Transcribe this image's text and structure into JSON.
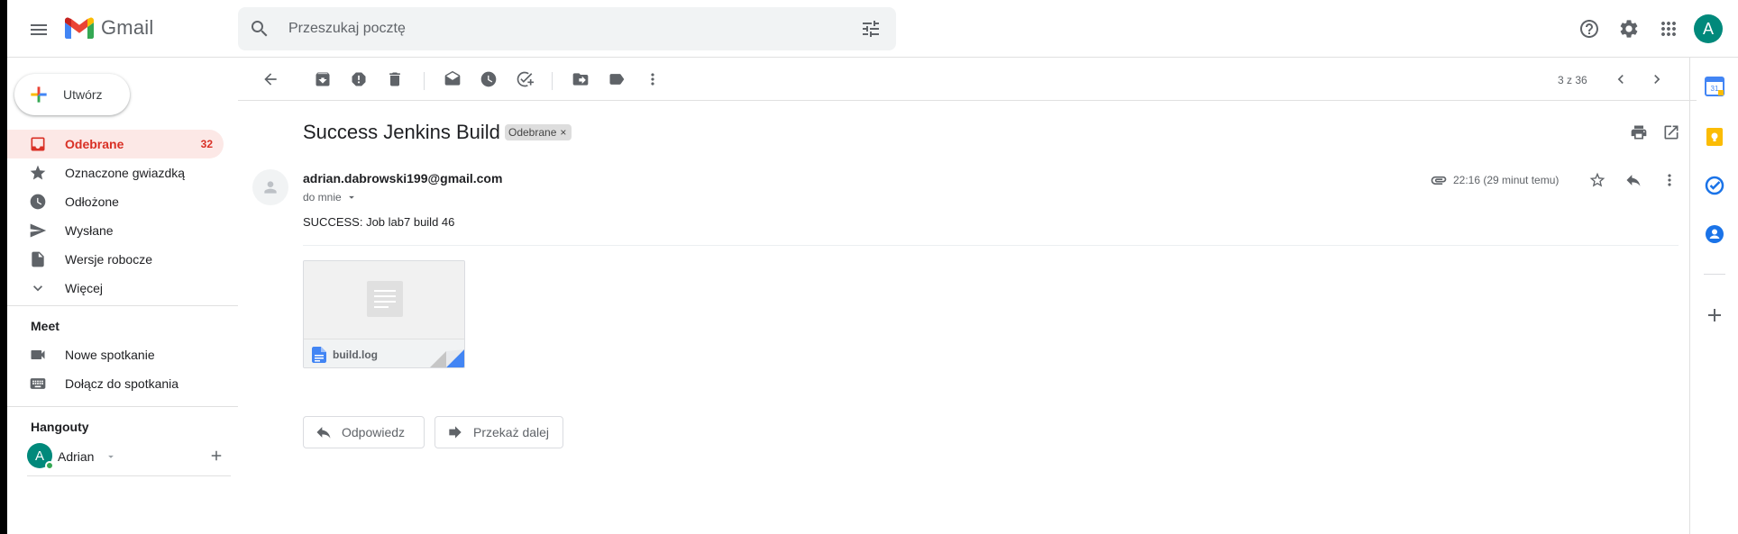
{
  "header": {
    "app_name": "Gmail",
    "search_placeholder": "Przeszukaj pocztę",
    "account_initial": "A"
  },
  "sidebar": {
    "compose_label": "Utwórz",
    "items": [
      {
        "label": "Odebrane",
        "count": "32"
      },
      {
        "label": "Oznaczone gwiazdką"
      },
      {
        "label": "Odłożone"
      },
      {
        "label": "Wysłane"
      },
      {
        "label": "Wersje robocze"
      },
      {
        "label": "Więcej"
      }
    ],
    "meet_title": "Meet",
    "meet_items": [
      {
        "label": "Nowe spotkanie"
      },
      {
        "label": "Dołącz do spotkania"
      }
    ],
    "hangouts_title": "Hangouty",
    "hangouts_user": {
      "initial": "A",
      "name": "Adrian"
    }
  },
  "toolbar": {
    "pager": "3 z 36"
  },
  "message": {
    "subject": "Success Jenkins Build",
    "label_chip": "Odebrane",
    "label_chip_close": "×",
    "sender": "adrian.dabrowski199@gmail.com",
    "recipient": "do mnie",
    "time": "22:16 (29 minut temu)",
    "body": "SUCCESS: Job lab7 build 46",
    "attachment": {
      "name": "build.log"
    },
    "reply_button": "Odpowiedz",
    "forward_button": "Przekaż dalej"
  },
  "right_panel": {
    "calendar_day": "31"
  },
  "colors": {
    "active_nav_bg": "#fce8e6",
    "active_nav_text": "#d93025",
    "avatar": "#00897b",
    "online": "#34a853"
  }
}
